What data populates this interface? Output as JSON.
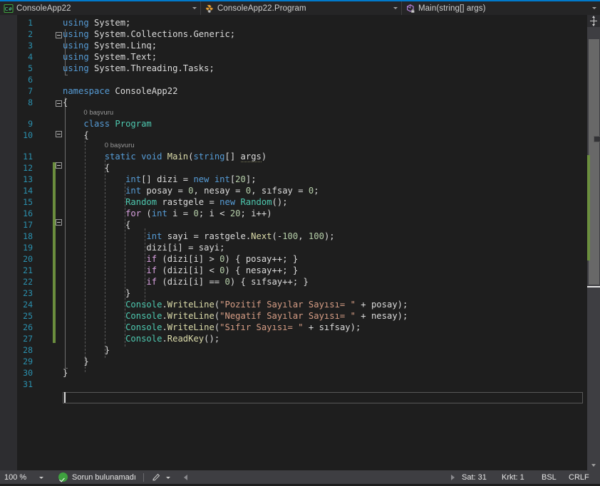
{
  "breadcrumb": {
    "project": {
      "label": "ConsoleApp22",
      "icon": "csharp-project-icon"
    },
    "class": {
      "label": "ConsoleApp22.Program",
      "icon": "class-icon"
    },
    "member": {
      "label": "Main(string[] args)",
      "icon": "method-icon"
    }
  },
  "editor": {
    "codelens": [
      {
        "line": 9,
        "text": "0 başvuru"
      },
      {
        "line": 11,
        "text": "0 başvuru"
      }
    ],
    "lines": [
      {
        "n": "1",
        "tokens": [
          {
            "t": "using ",
            "c": "kw"
          },
          {
            "t": "System;",
            "c": "pln"
          }
        ]
      },
      {
        "n": "2",
        "tokens": [
          {
            "t": "using ",
            "c": "kw"
          },
          {
            "t": "System.Collections.Generic;",
            "c": "pln"
          }
        ]
      },
      {
        "n": "3",
        "tokens": [
          {
            "t": "using ",
            "c": "kw"
          },
          {
            "t": "System.Linq;",
            "c": "pln"
          }
        ]
      },
      {
        "n": "4",
        "tokens": [
          {
            "t": "using ",
            "c": "kw"
          },
          {
            "t": "System.Text;",
            "c": "pln"
          }
        ]
      },
      {
        "n": "5",
        "tokens": [
          {
            "t": "using ",
            "c": "kw"
          },
          {
            "t": "System.Threading.Tasks;",
            "c": "pln"
          }
        ]
      },
      {
        "n": "6",
        "tokens": []
      },
      {
        "n": "7",
        "tokens": [
          {
            "t": "namespace ",
            "c": "kw"
          },
          {
            "t": "ConsoleApp22",
            "c": "pln"
          }
        ]
      },
      {
        "n": "8",
        "tokens": [
          {
            "t": "{",
            "c": "pln"
          }
        ]
      },
      {
        "n": "9",
        "tokens": [
          {
            "t": "    ",
            "c": "pln"
          },
          {
            "t": "class ",
            "c": "kw"
          },
          {
            "t": "Program",
            "c": "type"
          }
        ]
      },
      {
        "n": "10",
        "tokens": [
          {
            "t": "    {",
            "c": "pln"
          }
        ]
      },
      {
        "n": "11",
        "tokens": [
          {
            "t": "        ",
            "c": "pln"
          },
          {
            "t": "static void ",
            "c": "kw"
          },
          {
            "t": "Main",
            "c": "meth"
          },
          {
            "t": "(",
            "c": "pln"
          },
          {
            "t": "string",
            "c": "kw"
          },
          {
            "t": "[] ",
            "c": "pln"
          },
          {
            "t": "args",
            "c": "squig"
          },
          {
            "t": ")",
            "c": "pln"
          }
        ]
      },
      {
        "n": "12",
        "tokens": [
          {
            "t": "        {",
            "c": "pln"
          }
        ]
      },
      {
        "n": "13",
        "tokens": [
          {
            "t": "            ",
            "c": "pln"
          },
          {
            "t": "int",
            "c": "kw"
          },
          {
            "t": "[] dizi = ",
            "c": "pln"
          },
          {
            "t": "new ",
            "c": "kw"
          },
          {
            "t": "int",
            "c": "kw"
          },
          {
            "t": "[",
            "c": "pln"
          },
          {
            "t": "20",
            "c": "num"
          },
          {
            "t": "];",
            "c": "pln"
          }
        ]
      },
      {
        "n": "14",
        "tokens": [
          {
            "t": "            ",
            "c": "pln"
          },
          {
            "t": "int",
            "c": "kw"
          },
          {
            "t": " posay = ",
            "c": "pln"
          },
          {
            "t": "0",
            "c": "num"
          },
          {
            "t": ", nesay = ",
            "c": "pln"
          },
          {
            "t": "0",
            "c": "num"
          },
          {
            "t": ", sıfsay = ",
            "c": "pln"
          },
          {
            "t": "0",
            "c": "num"
          },
          {
            "t": ";",
            "c": "pln"
          }
        ]
      },
      {
        "n": "15",
        "tokens": [
          {
            "t": "            ",
            "c": "pln"
          },
          {
            "t": "Random",
            "c": "type"
          },
          {
            "t": " rastgele = ",
            "c": "pln"
          },
          {
            "t": "new ",
            "c": "kw"
          },
          {
            "t": "Random",
            "c": "type"
          },
          {
            "t": "();",
            "c": "pln"
          }
        ]
      },
      {
        "n": "16",
        "tokens": [
          {
            "t": "            ",
            "c": "pln"
          },
          {
            "t": "for ",
            "c": "ctl"
          },
          {
            "t": "(",
            "c": "pln"
          },
          {
            "t": "int",
            "c": "kw"
          },
          {
            "t": " i = ",
            "c": "pln"
          },
          {
            "t": "0",
            "c": "num"
          },
          {
            "t": "; i < ",
            "c": "pln"
          },
          {
            "t": "20",
            "c": "num"
          },
          {
            "t": "; i++)",
            "c": "pln"
          }
        ]
      },
      {
        "n": "17",
        "tokens": [
          {
            "t": "            {",
            "c": "pln"
          }
        ]
      },
      {
        "n": "18",
        "tokens": [
          {
            "t": "                ",
            "c": "pln"
          },
          {
            "t": "int",
            "c": "kw"
          },
          {
            "t": " sayi = rastgele.",
            "c": "pln"
          },
          {
            "t": "Next",
            "c": "meth"
          },
          {
            "t": "(-",
            "c": "pln"
          },
          {
            "t": "100",
            "c": "num"
          },
          {
            "t": ", ",
            "c": "pln"
          },
          {
            "t": "100",
            "c": "num"
          },
          {
            "t": ");",
            "c": "pln"
          }
        ]
      },
      {
        "n": "19",
        "tokens": [
          {
            "t": "                dizi[i] = sayi;",
            "c": "pln"
          }
        ]
      },
      {
        "n": "20",
        "tokens": [
          {
            "t": "                ",
            "c": "pln"
          },
          {
            "t": "if ",
            "c": "ctl"
          },
          {
            "t": "(dizi[i] > ",
            "c": "pln"
          },
          {
            "t": "0",
            "c": "num"
          },
          {
            "t": ") { posay++; }",
            "c": "pln"
          }
        ]
      },
      {
        "n": "21",
        "tokens": [
          {
            "t": "                ",
            "c": "pln"
          },
          {
            "t": "if ",
            "c": "ctl"
          },
          {
            "t": "(dizi[i] < ",
            "c": "pln"
          },
          {
            "t": "0",
            "c": "num"
          },
          {
            "t": ") { nesay++; }",
            "c": "pln"
          }
        ]
      },
      {
        "n": "22",
        "tokens": [
          {
            "t": "                ",
            "c": "pln"
          },
          {
            "t": "if ",
            "c": "ctl"
          },
          {
            "t": "(dizi[i] == ",
            "c": "pln"
          },
          {
            "t": "0",
            "c": "num"
          },
          {
            "t": ") { sıfsay++; }",
            "c": "pln"
          }
        ]
      },
      {
        "n": "23",
        "tokens": [
          {
            "t": "            }",
            "c": "pln"
          }
        ]
      },
      {
        "n": "24",
        "tokens": [
          {
            "t": "            ",
            "c": "pln"
          },
          {
            "t": "Console",
            "c": "type"
          },
          {
            "t": ".",
            "c": "pln"
          },
          {
            "t": "WriteLine",
            "c": "meth"
          },
          {
            "t": "(",
            "c": "pln"
          },
          {
            "t": "\"Pozitif Sayılar Sayısı= \"",
            "c": "str"
          },
          {
            "t": " + posay);",
            "c": "pln"
          }
        ]
      },
      {
        "n": "25",
        "tokens": [
          {
            "t": "            ",
            "c": "pln"
          },
          {
            "t": "Console",
            "c": "type"
          },
          {
            "t": ".",
            "c": "pln"
          },
          {
            "t": "WriteLine",
            "c": "meth"
          },
          {
            "t": "(",
            "c": "pln"
          },
          {
            "t": "\"Negatif Sayılar Sayısı= \"",
            "c": "str"
          },
          {
            "t": " + nesay);",
            "c": "pln"
          }
        ]
      },
      {
        "n": "26",
        "tokens": [
          {
            "t": "            ",
            "c": "pln"
          },
          {
            "t": "Console",
            "c": "type"
          },
          {
            "t": ".",
            "c": "pln"
          },
          {
            "t": "WriteLine",
            "c": "meth"
          },
          {
            "t": "(",
            "c": "pln"
          },
          {
            "t": "\"Sıfır Sayısı= \"",
            "c": "str"
          },
          {
            "t": " + sıfsay);",
            "c": "pln"
          }
        ]
      },
      {
        "n": "27",
        "tokens": [
          {
            "t": "            ",
            "c": "pln"
          },
          {
            "t": "Console",
            "c": "type"
          },
          {
            "t": ".",
            "c": "pln"
          },
          {
            "t": "ReadKey",
            "c": "meth"
          },
          {
            "t": "();",
            "c": "pln"
          }
        ]
      },
      {
        "n": "28",
        "tokens": [
          {
            "t": "        }",
            "c": "pln"
          }
        ]
      },
      {
        "n": "29",
        "tokens": [
          {
            "t": "    }",
            "c": "pln"
          }
        ]
      },
      {
        "n": "30",
        "tokens": [
          {
            "t": "}",
            "c": "pln"
          }
        ]
      },
      {
        "n": "31",
        "tokens": []
      }
    ]
  },
  "statusbar": {
    "zoom": "100 %",
    "status": "Sorun bulunamadı",
    "line": "Sat: 31",
    "column": "Krkt: 1",
    "insert_mode": "BSL",
    "line_ending": "CRLF"
  },
  "colors": {
    "accent": "#007ACC",
    "editor_bg": "#1E1E1E",
    "gutter_bg": "#2D2D30",
    "statusbar_bg": "#3E3E42",
    "linenumber": "#2B91AF",
    "keyword": "#569CD6",
    "type": "#4EC9B0",
    "method": "#DCDCAA",
    "string": "#D69D85",
    "number": "#B5CEA8",
    "control": "#D8A0DF",
    "changebar": "#6B8E3E",
    "ok_green": "#3FA13F"
  }
}
